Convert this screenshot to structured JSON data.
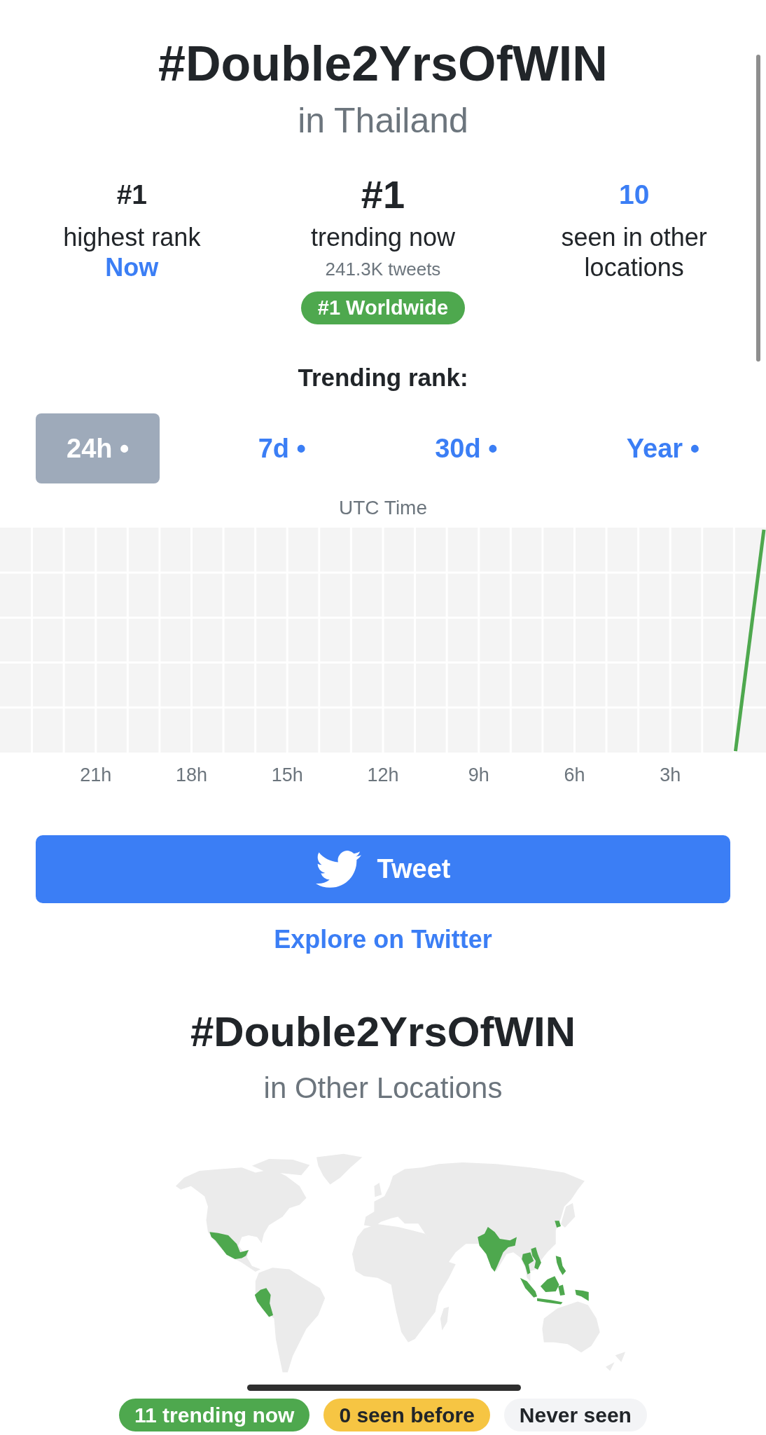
{
  "header": {
    "title": "#Double2YrsOfWIN",
    "subtitle": "in Thailand"
  },
  "stats": [
    {
      "kind": "highest",
      "value": "#1",
      "label": "highest rank",
      "note": "Now"
    },
    {
      "kind": "current",
      "value": "#1",
      "label": "trending now",
      "note": "241.3K tweets",
      "badge": "#1 Worldwide"
    },
    {
      "kind": "locations",
      "value": "10",
      "label": "seen in other locations"
    }
  ],
  "trending_rank": {
    "title": "Trending rank:",
    "tabs": [
      {
        "label": "24h •",
        "selected": true
      },
      {
        "label": "7d •",
        "selected": false
      },
      {
        "label": "30d •",
        "selected": false
      },
      {
        "label": "Year •",
        "selected": false
      }
    ],
    "axis_title": "UTC Time",
    "x_labels": [
      "21h",
      "18h",
      "15h",
      "12h",
      "9h",
      "6h",
      "3h"
    ]
  },
  "actions": {
    "tweet_button": "Tweet",
    "explore_link": "Explore on Twitter"
  },
  "other_locations": {
    "title": "#Double2YrsOfWIN",
    "subtitle": "in Other Locations",
    "legend": [
      {
        "label": "11 trending now",
        "color": "#4ea84e"
      },
      {
        "label": "0 seen before",
        "color": "#f6c543"
      },
      {
        "label": "Never seen",
        "color": "#f3f4f6"
      }
    ]
  }
}
